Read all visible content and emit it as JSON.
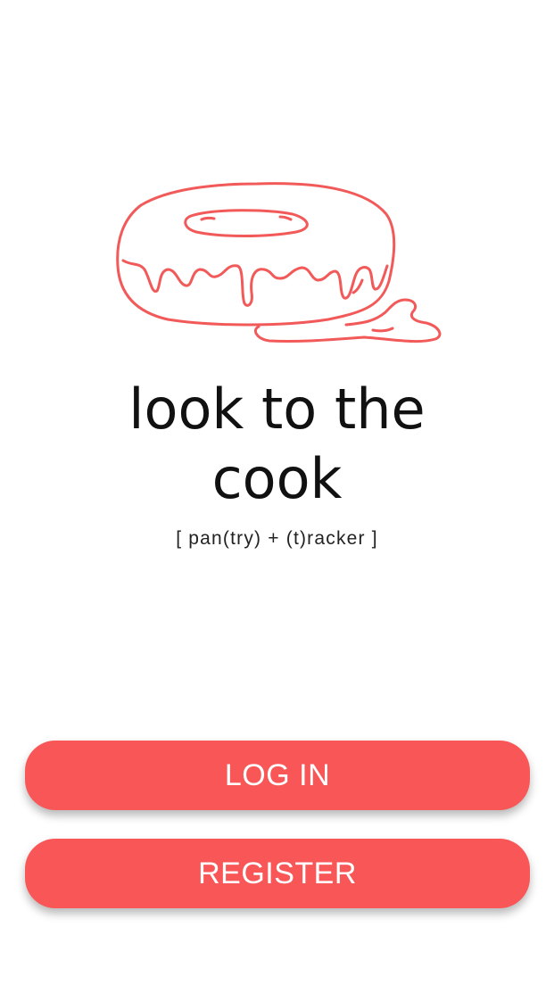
{
  "app": {
    "title_line1": "look to the",
    "title_line2": "cook",
    "subtitle": "[ pan(try) + (t)racker ]"
  },
  "logo": {
    "icon": "donut-icon",
    "color": "#f25a5a"
  },
  "actions": {
    "login_label": "LOG IN",
    "register_label": "REGISTER"
  },
  "colors": {
    "accent": "#f95757",
    "text": "#111111",
    "background": "#ffffff"
  }
}
